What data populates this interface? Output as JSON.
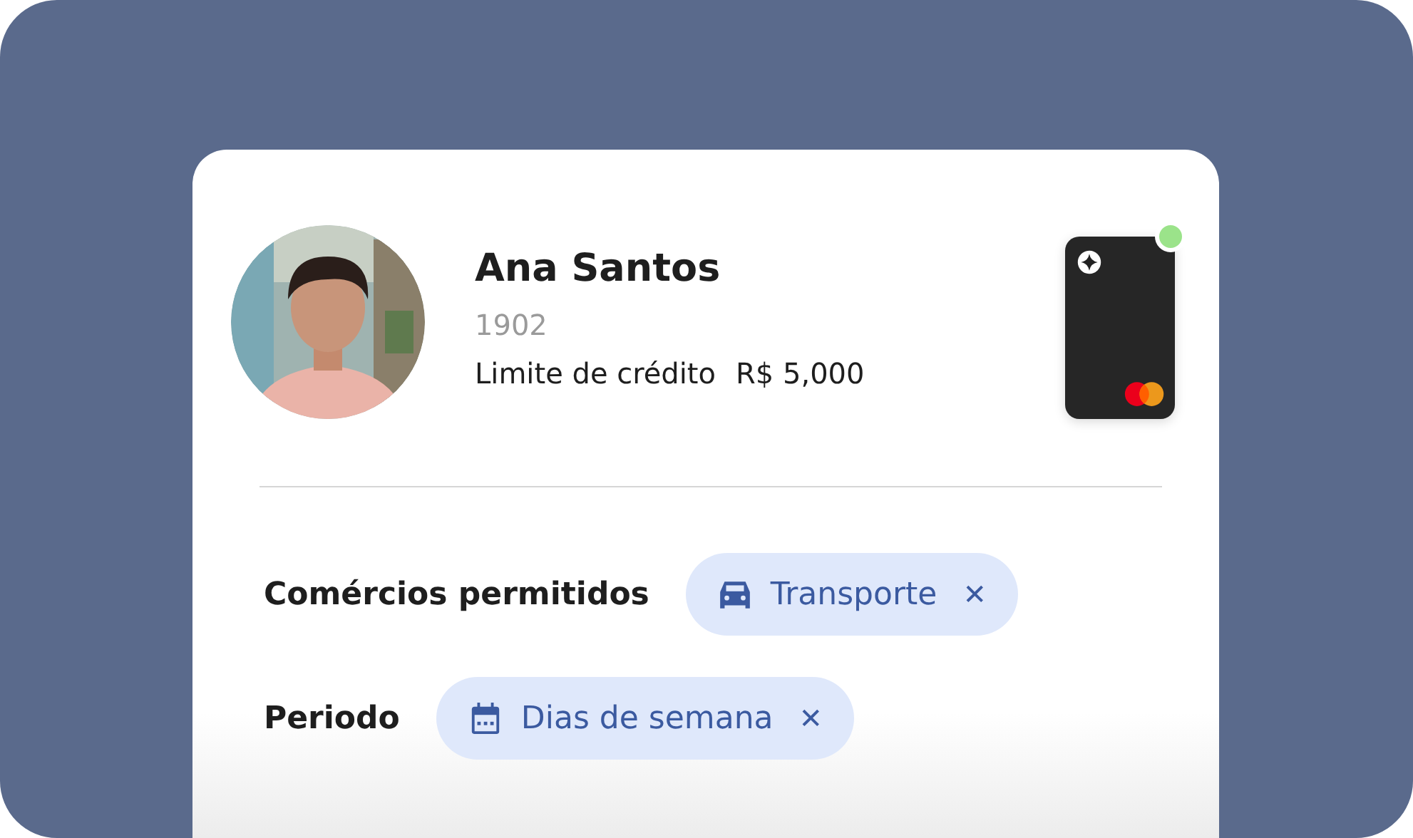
{
  "profile": {
    "name": "Ana Santos",
    "id": "1902",
    "limit_label": "Limite de crédito",
    "limit_value": "R$ 5,000"
  },
  "card": {
    "active": true
  },
  "filters": [
    {
      "label": "Comércios permitidos",
      "chip": {
        "text": "Transporte",
        "kind": "car",
        "close": "✕"
      }
    },
    {
      "label": "Periodo",
      "chip": {
        "text": "Dias de semana",
        "kind": "calendar",
        "close": "✕"
      }
    }
  ]
}
